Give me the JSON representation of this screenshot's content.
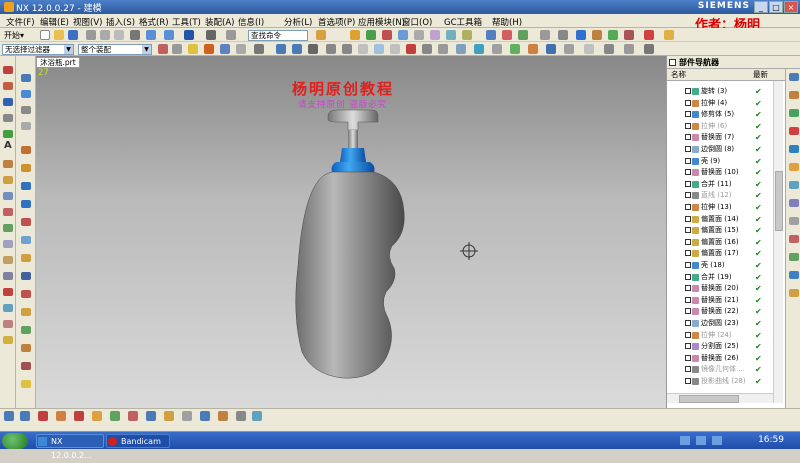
{
  "window": {
    "title": "NX 12.0.0.27 - 建模",
    "brand": "SIEMENS",
    "controls": [
      "_",
      "□",
      "×"
    ]
  },
  "watermark_author": "作者：杨明",
  "menu": [
    "文件(F)",
    "编辑(E)",
    "视图(V)",
    "插入(S)",
    "格式(R)",
    "工具(T)",
    "装配(A)",
    "信息(I)",
    "分析(L)",
    "首选项(P)",
    "应用模块(N)",
    "窗口(O)",
    "GC工具箱",
    "帮助(H)"
  ],
  "toolbar": {
    "start_label": "开始▾",
    "command_search_placeholder": "查找命令",
    "filter_label": "无选择过滤器",
    "assembly_label": "整个装配"
  },
  "viewport": {
    "tab_label": "沐浴瓶.prt",
    "coord_text": "27",
    "watermark_title": "杨明原创教程",
    "watermark_subtitle": "请支持原创 盗版必究"
  },
  "part_navigator": {
    "title": "部件导航器",
    "col_name": "名称",
    "col_latest": "最新",
    "items": [
      {
        "label": "旋转 (3)",
        "color": "#4a8",
        "dim": false
      },
      {
        "label": "拉伸 (4)",
        "color": "#c84",
        "dim": false
      },
      {
        "label": "修剪体 (5)",
        "color": "#48c",
        "dim": false
      },
      {
        "label": "拉伸 (6)",
        "color": "#c84",
        "dim": true
      },
      {
        "label": "替换面 (7)",
        "color": "#c8a",
        "dim": false
      },
      {
        "label": "边倒圆 (8)",
        "color": "#8ac",
        "dim": false
      },
      {
        "label": "壳 (9)",
        "color": "#48c",
        "dim": false
      },
      {
        "label": "替换面 (10)",
        "color": "#c8a",
        "dim": false
      },
      {
        "label": "合并 (11)",
        "color": "#4a8",
        "dim": false
      },
      {
        "label": "直线 (12)",
        "color": "#888",
        "dim": true
      },
      {
        "label": "拉伸 (13)",
        "color": "#c84",
        "dim": false
      },
      {
        "label": "偏置面 (14)",
        "color": "#ca4",
        "dim": false
      },
      {
        "label": "偏置面 (15)",
        "color": "#ca4",
        "dim": false
      },
      {
        "label": "偏置面 (16)",
        "color": "#ca4",
        "dim": false
      },
      {
        "label": "偏置面 (17)",
        "color": "#ca4",
        "dim": false
      },
      {
        "label": "壳 (18)",
        "color": "#48c",
        "dim": false
      },
      {
        "label": "合并 (19)",
        "color": "#4a8",
        "dim": false
      },
      {
        "label": "替换面 (20)",
        "color": "#c8a",
        "dim": false
      },
      {
        "label": "替换面 (21)",
        "color": "#c8a",
        "dim": false
      },
      {
        "label": "替换面 (22)",
        "color": "#c8a",
        "dim": false
      },
      {
        "label": "边倒圆 (23)",
        "color": "#8ac",
        "dim": false
      },
      {
        "label": "拉伸 (24)",
        "color": "#c84",
        "dim": true
      },
      {
        "label": "分割面 (25)",
        "color": "#a8c",
        "dim": false
      },
      {
        "label": "替换面 (26)",
        "color": "#c8a",
        "dim": false
      },
      {
        "label": "镜像几何体 ...",
        "color": "#888",
        "dim": true
      },
      {
        "label": "投影曲线 (28)",
        "color": "#888",
        "dim": true
      }
    ],
    "check_mark": "✔"
  },
  "taskbar": {
    "tasks": [
      "NX 12.0.0.2...",
      "Bandicam"
    ],
    "clock": "16:59"
  }
}
